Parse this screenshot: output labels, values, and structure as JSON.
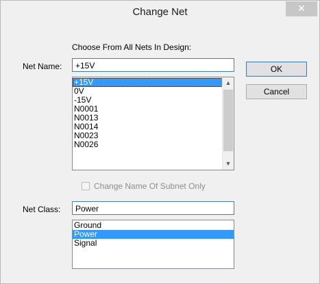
{
  "window": {
    "title": "Change Net",
    "close_glyph": "✕"
  },
  "header_label": "Choose From All Nets In Design:",
  "net_name": {
    "label": "Net Name:",
    "value": "+15V"
  },
  "net_list": {
    "items": [
      "+15V",
      "0V",
      "-15V",
      "N0001",
      "N0013",
      "N0014",
      "N0023",
      "N0026"
    ],
    "selected_index": 0,
    "scroll_up_glyph": "▲",
    "scroll_down_glyph": "▼"
  },
  "buttons": {
    "ok": "OK",
    "cancel": "Cancel"
  },
  "subnet_checkbox": {
    "label": "Change Name Of Subnet  Only",
    "checked": false,
    "enabled": false
  },
  "net_class": {
    "label": "Net Class:",
    "value": "Power"
  },
  "class_list": {
    "items": [
      "Ground",
      "Power",
      "Signal"
    ],
    "selected_index": 1
  },
  "colors": {
    "selection": "#3399ff",
    "focus_border": "#3c7fb1"
  }
}
